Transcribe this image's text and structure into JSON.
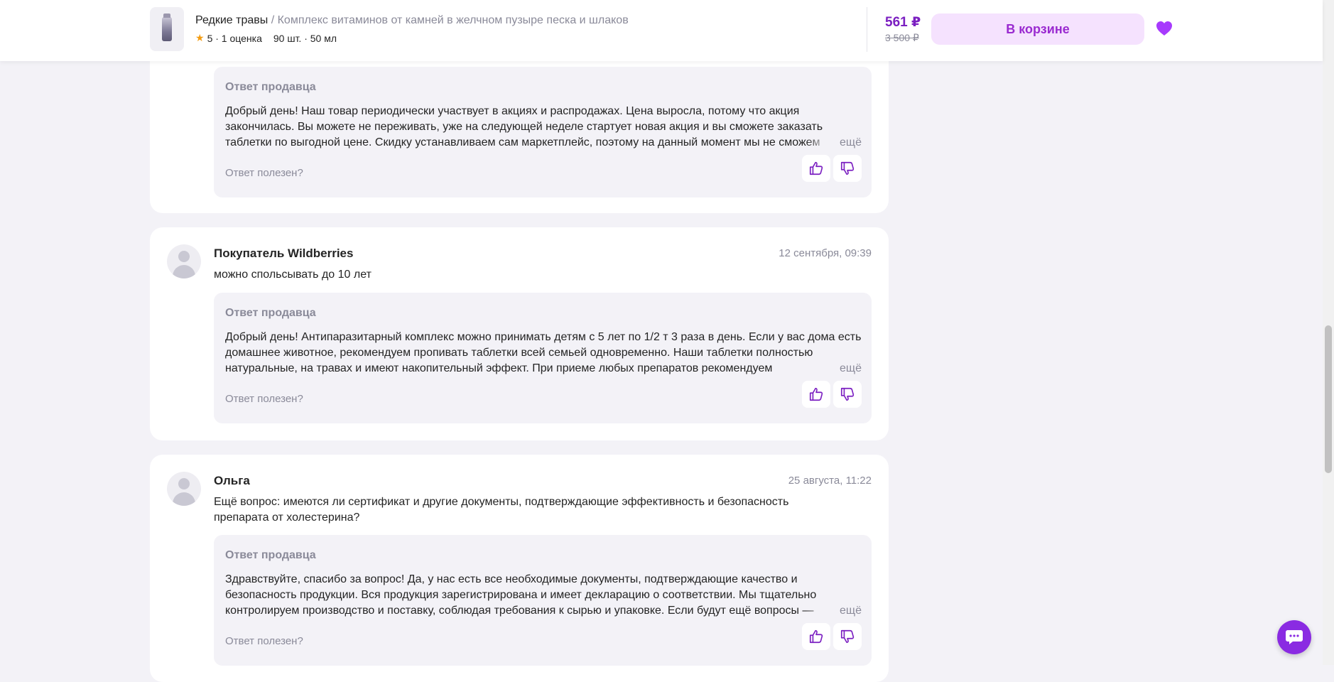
{
  "header": {
    "brand": "Редкие травы",
    "separator": " / ",
    "product_name": "Комплекс витаминов от камней в желчном пузыре песка и шлаков",
    "rating": "5",
    "rating_count": "· 1 оценка",
    "pack": "90 шт. · 50 мл",
    "price": "561 ₽",
    "old_price": "3 500 ₽",
    "cart_label": "В корзине",
    "icons": {
      "favorite": "heart-icon",
      "rating": "star-icon"
    },
    "colors": {
      "accent": "#7b1fc1",
      "cart_bg": "#f5e2fe",
      "heart": "#a73afd"
    }
  },
  "questions": [
    {
      "answer": {
        "title": "Ответ продавца",
        "text": "Добрый день! Наш товар периодически участвует в акциях и распродажах. Цена выросла, потому что акция закончилась. Вы можете не переживать, уже на следующей неделе стартует новая акция и вы сможете заказать таблетки по выгодной цене. Скидку устанавливаем сам маркетплейс, поэтому на данный момент мы не сможем",
        "more": "ещё",
        "helpful": "Ответ полезен?"
      }
    },
    {
      "author": "Покупатель Wildberries",
      "date": "12 сентября, 09:39",
      "text": "можно спольсывать до 10 лет",
      "answer": {
        "title": "Ответ продавца",
        "text": "Добрый день! Антипаразитарный комплекс можно принимать детям с 5 лет по 1/2 т 3 раза в день. Если у вас дома есть домашнее животное, рекомендуем пропивать таблетки всей семьей одновременно. Наши таблетки полностью натуральные, на травах и имеют накопительный эффект. При приеме любых препаратов рекомендуем",
        "more": "ещё",
        "helpful": "Ответ полезен?"
      }
    },
    {
      "author": "Ольга",
      "date": "25 августа, 11:22",
      "text": "Ещё вопрос: имеются ли сертификат и другие документы, подтверждающие эффективность и безопасность препарата от холестерина?",
      "answer": {
        "title": "Ответ продавца",
        "text": "Здравствуйте, спасибо за вопрос! Да, у нас есть все необходимые документы, подтверждающие качество и безопасность продукции. Вся продукция зарегистрирована и имеет декларацию о соответствии. Мы тщательно контролируем производство и поставку, соблюдая требования к сырью и упаковке. Если будут ещё вопросы —",
        "more": "ещё",
        "helpful": "Ответ полезен?"
      }
    }
  ],
  "icons": {
    "like": "thumbs-up-icon",
    "dislike": "thumbs-down-icon",
    "chat": "chat-icon",
    "avatar": "user-avatar-icon"
  }
}
